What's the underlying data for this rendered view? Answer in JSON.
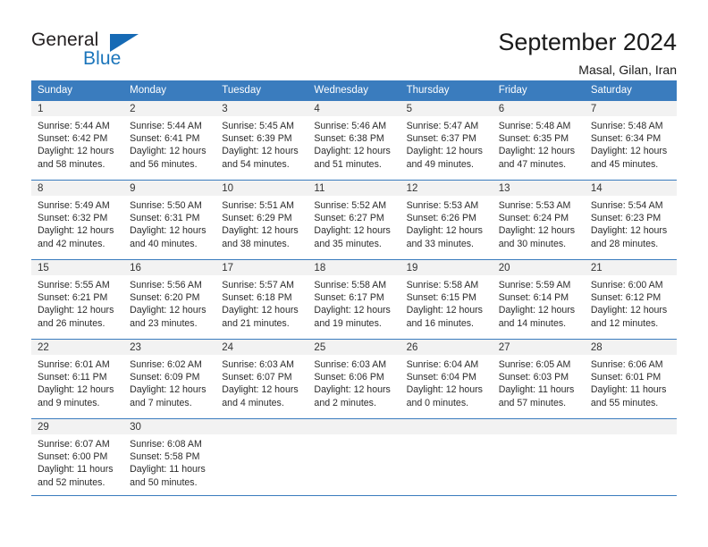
{
  "brand": {
    "word_one": "General",
    "word_two": "Blue",
    "triangle_color": "#166ab5",
    "blue_color": "#1b75bb"
  },
  "header": {
    "title": "September 2024",
    "subtitle": "Masal, Gilan, Iran"
  },
  "theme": {
    "header_bg": "#3a7cbe",
    "header_text": "#ffffff",
    "daynum_bg": "#f2f2f2",
    "cell_bg": "#ffffff",
    "border": "#3a7cbe"
  },
  "weekday_headers": [
    "Sunday",
    "Monday",
    "Tuesday",
    "Wednesday",
    "Thursday",
    "Friday",
    "Saturday"
  ],
  "labels": {
    "sunrise_prefix": "Sunrise:",
    "sunset_prefix": "Sunset:",
    "daylight_prefix": "Daylight:"
  },
  "weeks": [
    [
      {
        "day": "1",
        "sunrise": "Sunrise: 5:44 AM",
        "sunset": "Sunset: 6:42 PM",
        "daylight_1": "Daylight: 12 hours",
        "daylight_2": "and 58 minutes."
      },
      {
        "day": "2",
        "sunrise": "Sunrise: 5:44 AM",
        "sunset": "Sunset: 6:41 PM",
        "daylight_1": "Daylight: 12 hours",
        "daylight_2": "and 56 minutes."
      },
      {
        "day": "3",
        "sunrise": "Sunrise: 5:45 AM",
        "sunset": "Sunset: 6:39 PM",
        "daylight_1": "Daylight: 12 hours",
        "daylight_2": "and 54 minutes."
      },
      {
        "day": "4",
        "sunrise": "Sunrise: 5:46 AM",
        "sunset": "Sunset: 6:38 PM",
        "daylight_1": "Daylight: 12 hours",
        "daylight_2": "and 51 minutes."
      },
      {
        "day": "5",
        "sunrise": "Sunrise: 5:47 AM",
        "sunset": "Sunset: 6:37 PM",
        "daylight_1": "Daylight: 12 hours",
        "daylight_2": "and 49 minutes."
      },
      {
        "day": "6",
        "sunrise": "Sunrise: 5:48 AM",
        "sunset": "Sunset: 6:35 PM",
        "daylight_1": "Daylight: 12 hours",
        "daylight_2": "and 47 minutes."
      },
      {
        "day": "7",
        "sunrise": "Sunrise: 5:48 AM",
        "sunset": "Sunset: 6:34 PM",
        "daylight_1": "Daylight: 12 hours",
        "daylight_2": "and 45 minutes."
      }
    ],
    [
      {
        "day": "8",
        "sunrise": "Sunrise: 5:49 AM",
        "sunset": "Sunset: 6:32 PM",
        "daylight_1": "Daylight: 12 hours",
        "daylight_2": "and 42 minutes."
      },
      {
        "day": "9",
        "sunrise": "Sunrise: 5:50 AM",
        "sunset": "Sunset: 6:31 PM",
        "daylight_1": "Daylight: 12 hours",
        "daylight_2": "and 40 minutes."
      },
      {
        "day": "10",
        "sunrise": "Sunrise: 5:51 AM",
        "sunset": "Sunset: 6:29 PM",
        "daylight_1": "Daylight: 12 hours",
        "daylight_2": "and 38 minutes."
      },
      {
        "day": "11",
        "sunrise": "Sunrise: 5:52 AM",
        "sunset": "Sunset: 6:27 PM",
        "daylight_1": "Daylight: 12 hours",
        "daylight_2": "and 35 minutes."
      },
      {
        "day": "12",
        "sunrise": "Sunrise: 5:53 AM",
        "sunset": "Sunset: 6:26 PM",
        "daylight_1": "Daylight: 12 hours",
        "daylight_2": "and 33 minutes."
      },
      {
        "day": "13",
        "sunrise": "Sunrise: 5:53 AM",
        "sunset": "Sunset: 6:24 PM",
        "daylight_1": "Daylight: 12 hours",
        "daylight_2": "and 30 minutes."
      },
      {
        "day": "14",
        "sunrise": "Sunrise: 5:54 AM",
        "sunset": "Sunset: 6:23 PM",
        "daylight_1": "Daylight: 12 hours",
        "daylight_2": "and 28 minutes."
      }
    ],
    [
      {
        "day": "15",
        "sunrise": "Sunrise: 5:55 AM",
        "sunset": "Sunset: 6:21 PM",
        "daylight_1": "Daylight: 12 hours",
        "daylight_2": "and 26 minutes."
      },
      {
        "day": "16",
        "sunrise": "Sunrise: 5:56 AM",
        "sunset": "Sunset: 6:20 PM",
        "daylight_1": "Daylight: 12 hours",
        "daylight_2": "and 23 minutes."
      },
      {
        "day": "17",
        "sunrise": "Sunrise: 5:57 AM",
        "sunset": "Sunset: 6:18 PM",
        "daylight_1": "Daylight: 12 hours",
        "daylight_2": "and 21 minutes."
      },
      {
        "day": "18",
        "sunrise": "Sunrise: 5:58 AM",
        "sunset": "Sunset: 6:17 PM",
        "daylight_1": "Daylight: 12 hours",
        "daylight_2": "and 19 minutes."
      },
      {
        "day": "19",
        "sunrise": "Sunrise: 5:58 AM",
        "sunset": "Sunset: 6:15 PM",
        "daylight_1": "Daylight: 12 hours",
        "daylight_2": "and 16 minutes."
      },
      {
        "day": "20",
        "sunrise": "Sunrise: 5:59 AM",
        "sunset": "Sunset: 6:14 PM",
        "daylight_1": "Daylight: 12 hours",
        "daylight_2": "and 14 minutes."
      },
      {
        "day": "21",
        "sunrise": "Sunrise: 6:00 AM",
        "sunset": "Sunset: 6:12 PM",
        "daylight_1": "Daylight: 12 hours",
        "daylight_2": "and 12 minutes."
      }
    ],
    [
      {
        "day": "22",
        "sunrise": "Sunrise: 6:01 AM",
        "sunset": "Sunset: 6:11 PM",
        "daylight_1": "Daylight: 12 hours",
        "daylight_2": "and 9 minutes."
      },
      {
        "day": "23",
        "sunrise": "Sunrise: 6:02 AM",
        "sunset": "Sunset: 6:09 PM",
        "daylight_1": "Daylight: 12 hours",
        "daylight_2": "and 7 minutes."
      },
      {
        "day": "24",
        "sunrise": "Sunrise: 6:03 AM",
        "sunset": "Sunset: 6:07 PM",
        "daylight_1": "Daylight: 12 hours",
        "daylight_2": "and 4 minutes."
      },
      {
        "day": "25",
        "sunrise": "Sunrise: 6:03 AM",
        "sunset": "Sunset: 6:06 PM",
        "daylight_1": "Daylight: 12 hours",
        "daylight_2": "and 2 minutes."
      },
      {
        "day": "26",
        "sunrise": "Sunrise: 6:04 AM",
        "sunset": "Sunset: 6:04 PM",
        "daylight_1": "Daylight: 12 hours",
        "daylight_2": "and 0 minutes."
      },
      {
        "day": "27",
        "sunrise": "Sunrise: 6:05 AM",
        "sunset": "Sunset: 6:03 PM",
        "daylight_1": "Daylight: 11 hours",
        "daylight_2": "and 57 minutes."
      },
      {
        "day": "28",
        "sunrise": "Sunrise: 6:06 AM",
        "sunset": "Sunset: 6:01 PM",
        "daylight_1": "Daylight: 11 hours",
        "daylight_2": "and 55 minutes."
      }
    ],
    [
      {
        "day": "29",
        "sunrise": "Sunrise: 6:07 AM",
        "sunset": "Sunset: 6:00 PM",
        "daylight_1": "Daylight: 11 hours",
        "daylight_2": "and 52 minutes."
      },
      {
        "day": "30",
        "sunrise": "Sunrise: 6:08 AM",
        "sunset": "Sunset: 5:58 PM",
        "daylight_1": "Daylight: 11 hours",
        "daylight_2": "and 50 minutes."
      },
      {
        "day": "",
        "sunrise": "",
        "sunset": "",
        "daylight_1": "",
        "daylight_2": ""
      },
      {
        "day": "",
        "sunrise": "",
        "sunset": "",
        "daylight_1": "",
        "daylight_2": ""
      },
      {
        "day": "",
        "sunrise": "",
        "sunset": "",
        "daylight_1": "",
        "daylight_2": ""
      },
      {
        "day": "",
        "sunrise": "",
        "sunset": "",
        "daylight_1": "",
        "daylight_2": ""
      },
      {
        "day": "",
        "sunrise": "",
        "sunset": "",
        "daylight_1": "",
        "daylight_2": ""
      }
    ]
  ]
}
